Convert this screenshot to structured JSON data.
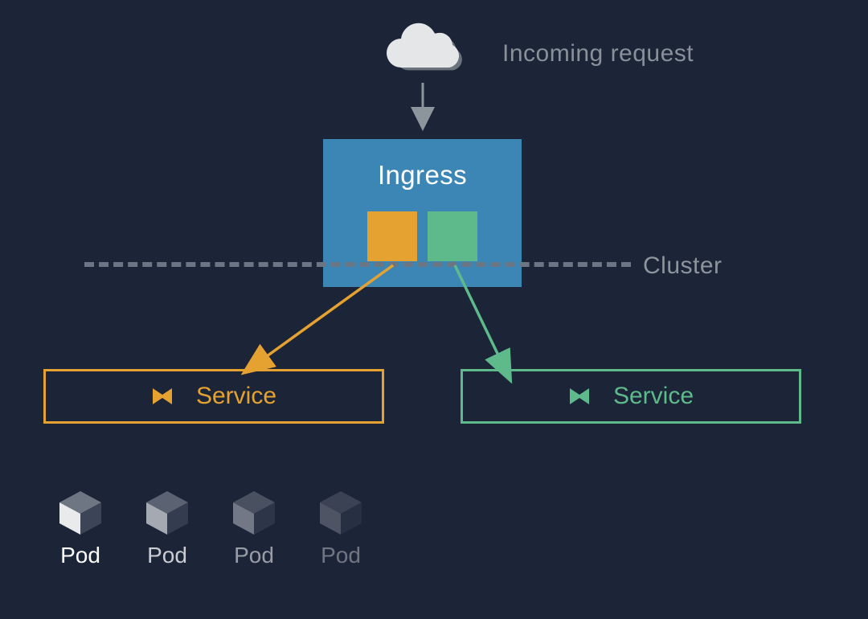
{
  "incoming": {
    "label": "Incoming request"
  },
  "ingress": {
    "title": "Ingress"
  },
  "cluster": {
    "label": "Cluster"
  },
  "services": {
    "left": {
      "label": "Service"
    },
    "right": {
      "label": "Service"
    }
  },
  "pods": [
    {
      "label": "Pod"
    },
    {
      "label": "Pod"
    },
    {
      "label": "Pod"
    },
    {
      "label": "Pod"
    }
  ],
  "colors": {
    "bg": "#1c2438",
    "ingress_box": "#3b86b5",
    "orange": "#e6a230",
    "green": "#5fba8b",
    "muted": "#889199"
  },
  "icons": {
    "cloud": "cloud-icon",
    "cube": "cube-icon",
    "service": "service-icon"
  }
}
